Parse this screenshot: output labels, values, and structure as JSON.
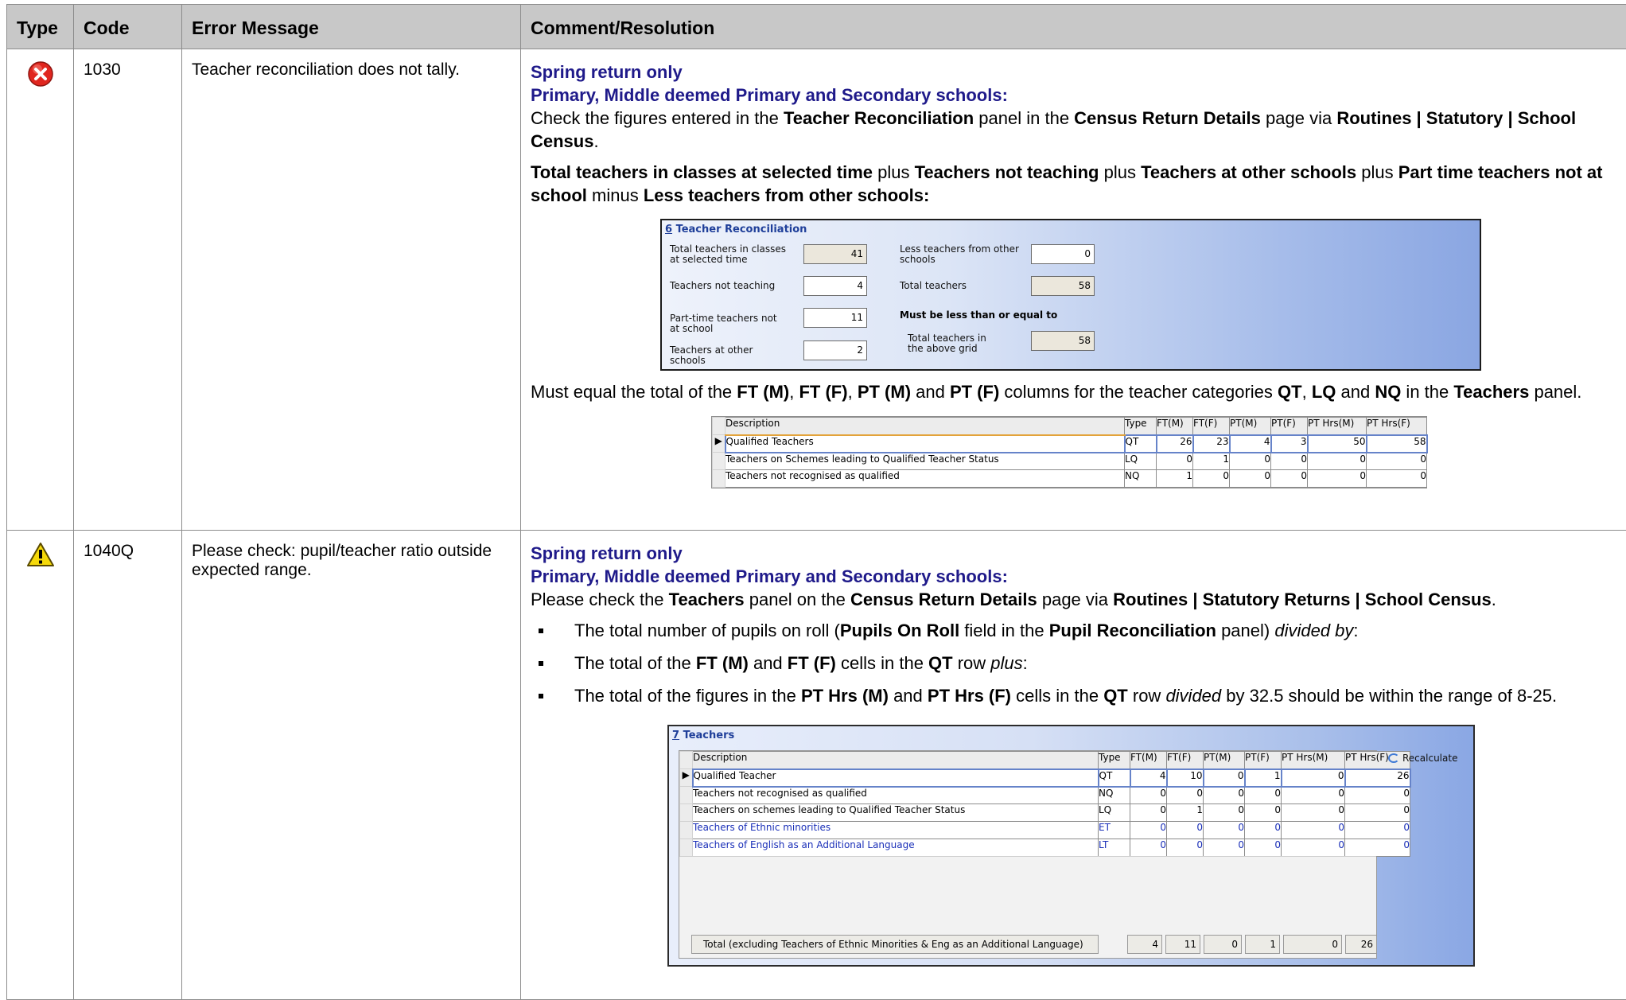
{
  "headers": {
    "type": "Type",
    "code": "Code",
    "error": "Error Message",
    "comment": "Comment/Resolution"
  },
  "rows": [
    {
      "icon": "error-icon",
      "code": "1030",
      "message": "Teacher reconciliation does not tally.",
      "heading1": "Spring return only",
      "heading2": "Primary, Middle deemed Primary and Secondary schools:",
      "check_pre": "Check the figures entered in the ",
      "check_b1": "Teacher Reconciliation",
      "check_mid1": " panel in the ",
      "check_b2": "Census Return Details",
      "check_mid2": " page via ",
      "check_b3": "Routines | Statutory | School Census",
      "check_end": ".",
      "formula": {
        "b1": "Total teachers in classes at selected time",
        "t1": " plus ",
        "b2": "Teachers not teaching",
        "t2": " plus ",
        "b3": "Teachers at other schools",
        "t3": " plus ",
        "b4": "Part time teachers not at school",
        "t4": " minus ",
        "b5": "Less teachers from other schools:"
      },
      "must": {
        "pre": "Must equal the total of the ",
        "b1": "FT (M)",
        "s1": ", ",
        "b2": "FT (F)",
        "s2": ", ",
        "b3": "PT (M)",
        "s3": " and ",
        "b4": "PT (F)",
        "mid": " columns for the teacher categories ",
        "b5": "QT",
        "s5": ", ",
        "b6": "LQ",
        "s6": " and ",
        "b7": "NQ",
        "mid2": " in the ",
        "b8": "Teachers",
        "end": " panel."
      }
    },
    {
      "icon": "warning-icon",
      "code": "1040Q",
      "message": "Please check: pupil/teacher ratio outside expected range.",
      "heading1": "Spring return only",
      "heading2": "Primary, Middle deemed Primary and Secondary schools:",
      "check_pre": "Please check the ",
      "check_b1": "Teachers",
      "check_mid1": " panel on the ",
      "check_b2": "Census Return Details",
      "check_mid2": " page via ",
      "check_b3": "Routines | Statutory Returns | School Census",
      "check_end": ".",
      "bullets": [
        {
          "pre": "The total number of pupils on roll (",
          "b1": "Pupils On Roll",
          "mid": " field in the ",
          "b2": "Pupil Reconciliation",
          "mid2": " panel) ",
          "i": "divided by",
          "end": ":"
        },
        {
          "pre": "The total of the ",
          "b1": "FT (M)",
          "mid": " and ",
          "b2": "FT (F)",
          "mid2": " cells in the ",
          "b3": "QT",
          "mid3": " row ",
          "i": "plus",
          "end": ":"
        },
        {
          "pre": "The total of the figures in the ",
          "b1": "PT Hrs (M)",
          "mid": " and ",
          "b2": "PT Hrs (F)",
          "mid2": " cells in the ",
          "b3": "QT",
          "mid3": " row ",
          "i": "divided",
          "end": " by 32.5 should be within the range of 8-25."
        }
      ]
    }
  ],
  "recon_panel": {
    "num": "6",
    "title": " Teacher Reconciliation",
    "total_in_classes_label_1": "Total teachers in classes",
    "total_in_classes_label_2": "at selected time",
    "total_in_classes": "41",
    "not_teaching_label": "Teachers not teaching",
    "not_teaching": "4",
    "part_time_label_1": "Part-time teachers not",
    "part_time_label_2": "at school",
    "part_time": "11",
    "other_schools_label_1": "Teachers at other",
    "other_schools_label_2": "schools",
    "other_schools": "2",
    "less_label_1": "Less teachers from other",
    "less_label_2": "schools",
    "less": "0",
    "total_label": "Total teachers",
    "total": "58",
    "must_label": "Must be less than or equal to",
    "grid_total_label_1": "Total teachers in",
    "grid_total_label_2": "the above grid",
    "grid_total": "58"
  },
  "grid1": {
    "columns": [
      "Description",
      "Type",
      "FT(M)",
      "FT(F)",
      "PT(M)",
      "PT(F)",
      "PT Hrs(M)",
      "PT Hrs(F)"
    ],
    "rows": [
      [
        "Qualified Teachers",
        "QT",
        "26",
        "23",
        "4",
        "3",
        "50",
        "58"
      ],
      [
        "Teachers on Schemes leading to Qualified Teacher Status",
        "LQ",
        "0",
        "1",
        "0",
        "0",
        "0",
        "0"
      ],
      [
        "Teachers not recognised as qualified",
        "NQ",
        "1",
        "0",
        "0",
        "0",
        "0",
        "0"
      ]
    ]
  },
  "teachers_panel": {
    "num": "7",
    "title": " Teachers",
    "recalculate": "Recalculate",
    "columns": [
      "Description",
      "Type",
      "FT(M)",
      "FT(F)",
      "PT(M)",
      "PT(F)",
      "PT Hrs(M)",
      "PT Hrs(F)"
    ],
    "rows": [
      [
        "Qualified Teacher",
        "QT",
        "4",
        "10",
        "0",
        "1",
        "0",
        "26"
      ],
      [
        "Teachers not recognised as qualified",
        "NQ",
        "0",
        "0",
        "0",
        "0",
        "0",
        "0"
      ],
      [
        "Teachers on schemes leading to Qualified Teacher Status",
        "LQ",
        "0",
        "1",
        "0",
        "0",
        "0",
        "0"
      ],
      [
        "Teachers of Ethnic minorities",
        "ET",
        "0",
        "0",
        "0",
        "0",
        "0",
        "0"
      ],
      [
        "Teachers of English as an Additional Language",
        "LT",
        "0",
        "0",
        "0",
        "0",
        "0",
        "0"
      ]
    ],
    "total_label": "Total (excluding Teachers of Ethnic Minorities & Eng as an Additional Language)",
    "totals": [
      "4",
      "11",
      "0",
      "1",
      "0",
      "26"
    ],
    "colors": {
      "link_rows": "#1a2fb8"
    }
  },
  "colors": {
    "header_bg": "#c8c8c8",
    "heading_blue": "#1f1a8a",
    "error_red": "#e0261f",
    "warning_yellow": "#f5d90a"
  }
}
